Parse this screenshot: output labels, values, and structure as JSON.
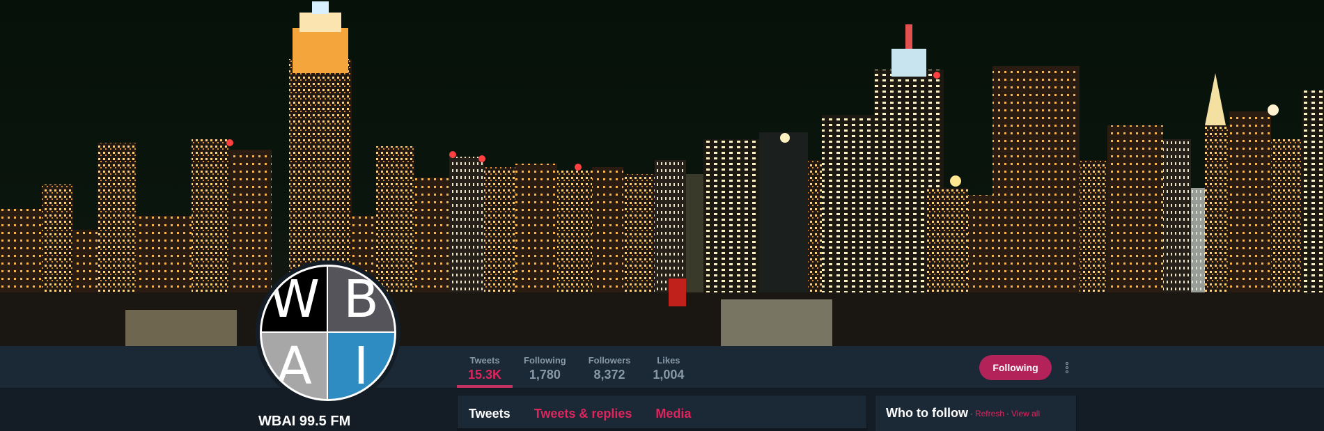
{
  "profile": {
    "name": "WBAI 99.5 FM",
    "avatar_letters": [
      "W",
      "B",
      "A",
      "I"
    ],
    "avatar_colors": [
      "#000000",
      "#56545b",
      "#a7a7a7",
      "#2f8cc2"
    ]
  },
  "stats": [
    {
      "label": "Tweets",
      "value": "15.3K",
      "active": true
    },
    {
      "label": "Following",
      "value": "1,780",
      "active": false
    },
    {
      "label": "Followers",
      "value": "8,372",
      "active": false
    },
    {
      "label": "Likes",
      "value": "1,004",
      "active": false
    }
  ],
  "actions": {
    "follow_label": "Following",
    "more_icon": "more-vertical-icon"
  },
  "tabs": [
    {
      "label": "Tweets",
      "active": true
    },
    {
      "label": "Tweets & replies",
      "active": false
    },
    {
      "label": "Media",
      "active": false
    }
  ],
  "who_to_follow": {
    "title": "Who to follow",
    "separator": "·",
    "refresh": "Refresh",
    "view_all": "View all"
  },
  "colors": {
    "accent": "#e0245e",
    "button_bg": "#b3235a",
    "nav_bg": "#1b2836",
    "page_bg": "#141d26"
  }
}
